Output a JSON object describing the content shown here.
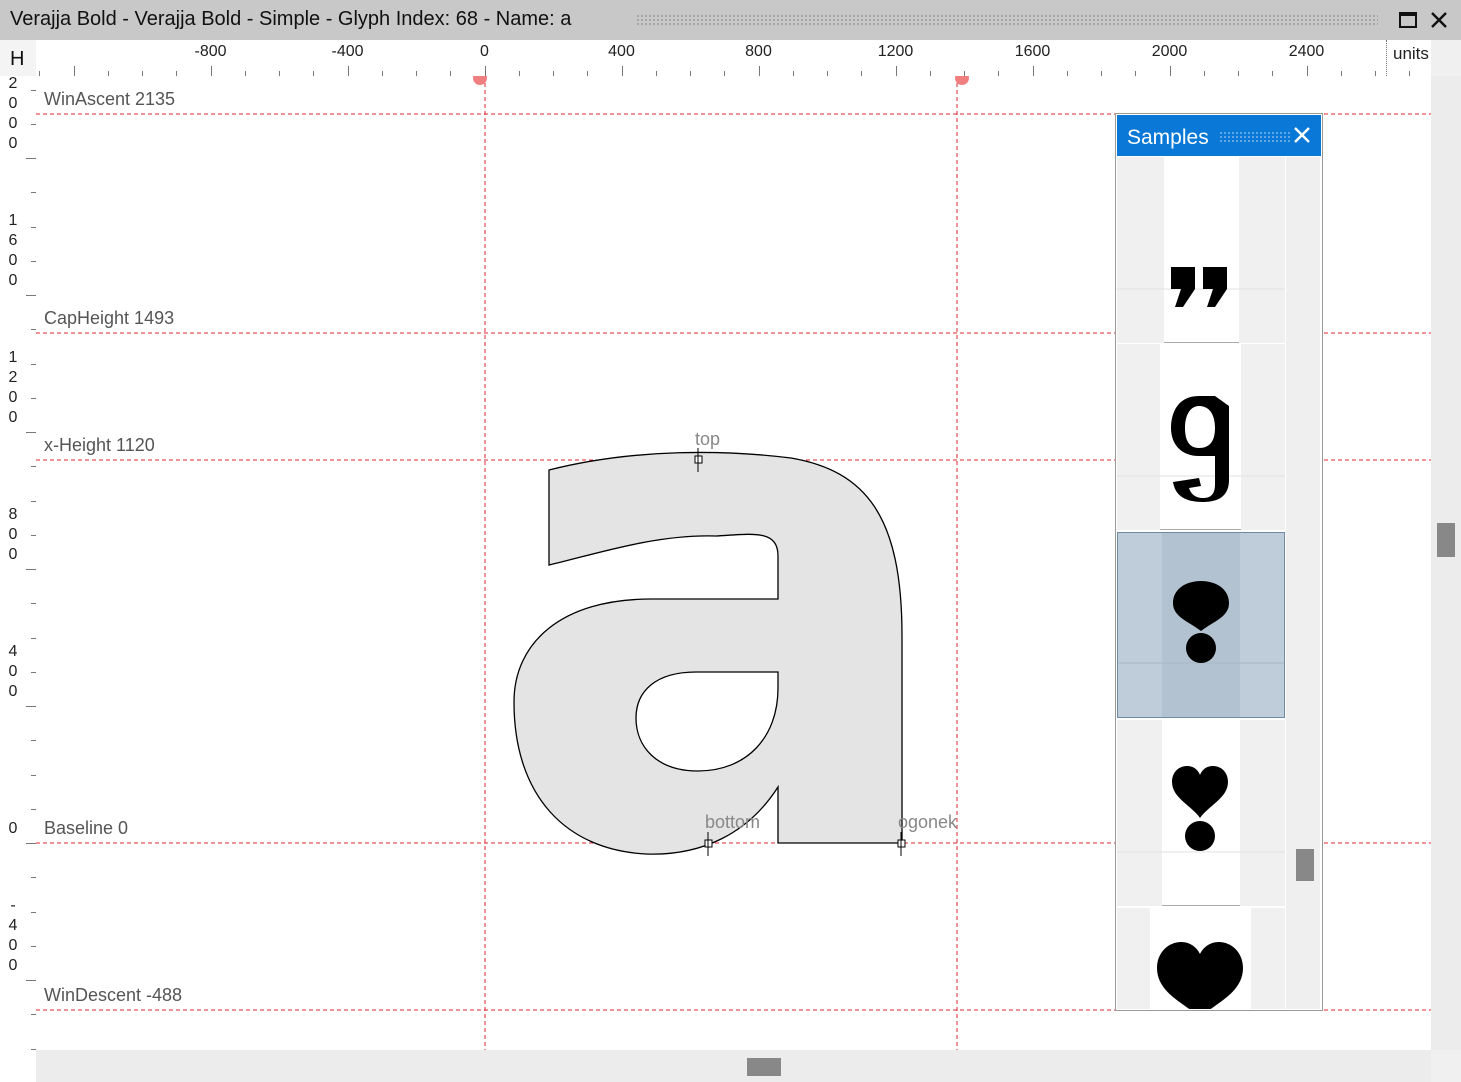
{
  "window": {
    "title": "Verajja Bold - Verajja Bold - Simple - Glyph Index: 68 - Name: a",
    "maximize_icon": "maximize-icon",
    "close_icon": "close-icon",
    "close_glyph": "✕",
    "maximize_glyph": "□"
  },
  "ruler": {
    "corner_label": "H",
    "units_label": "units",
    "h_labels": [
      "-800",
      "-400",
      "0",
      "400",
      "800",
      "1200",
      "1600",
      "2000",
      "2400"
    ],
    "v_labels": [
      "2000",
      "1600",
      "1200",
      "800",
      "400",
      "0",
      "-400"
    ]
  },
  "metrics": {
    "win_ascent": "WinAscent 2135",
    "cap_height": "CapHeight 1493",
    "x_height": "x-Height 1120",
    "baseline": "Baseline 0",
    "win_descent": "WinDescent -488"
  },
  "glyph": {
    "name": "a",
    "anchors": {
      "top": "top",
      "bottom": "bottom",
      "ogonek": "ogonek"
    }
  },
  "samples": {
    "title": "Samples",
    "close_glyph": "✕",
    "items": [
      {
        "name": "quotedblright",
        "selected": false
      },
      {
        "name": "g-variant",
        "selected": false
      },
      {
        "name": "exclam-heavy-ornament",
        "selected": true
      },
      {
        "name": "heart-exclamation",
        "selected": false
      },
      {
        "name": "heart",
        "selected": false
      }
    ]
  },
  "colors": {
    "guide": "#e0262e",
    "glyph_fill": "#e4e4e4",
    "accent": "#0a78d7",
    "selection": "#b7c6d4"
  }
}
